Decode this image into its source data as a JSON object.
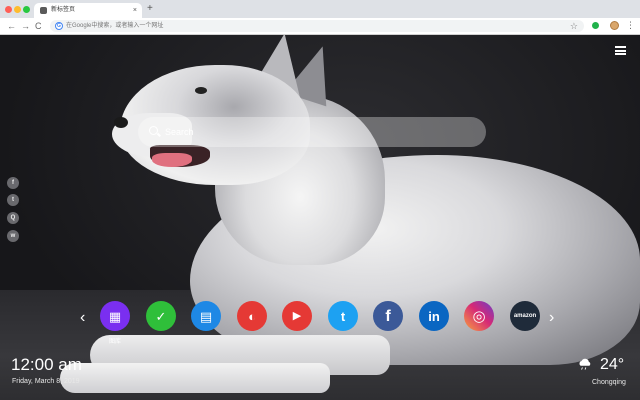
{
  "browser": {
    "tab_title": "新标签页",
    "tab_close": "×",
    "new_tab": "+",
    "back": "←",
    "forward": "→",
    "reload": "C",
    "omnibox_g": "G",
    "omnibox_placeholder": "在Google中搜索，或者输入一个网址",
    "star": "☆",
    "menu": "⋮"
  },
  "page": {
    "search": {
      "placeholder": "Search"
    },
    "social_links": [
      {
        "icon": "facebook-icon",
        "glyph": "f"
      },
      {
        "icon": "twitter-icon",
        "glyph": "t"
      },
      {
        "icon": "qq-icon",
        "glyph": "Q"
      },
      {
        "icon": "wechat-icon",
        "glyph": "w"
      }
    ],
    "dock": {
      "prev": "‹",
      "next": "›",
      "apps": [
        {
          "name": "gallery",
          "glyph": "▦",
          "label": "图库",
          "color": "#7a2ff0"
        },
        {
          "name": "checkmark",
          "glyph": "✓",
          "label": "",
          "color": "#2fbf3a"
        },
        {
          "name": "notes",
          "glyph": "▤",
          "label": "",
          "color": "#1e88e5"
        },
        {
          "name": "chrome-games",
          "glyph": "◐",
          "label": "",
          "color": "#e53935"
        },
        {
          "name": "youtube",
          "glyph": "▶",
          "label": "",
          "color": "#e53935"
        },
        {
          "name": "twitter",
          "glyph": "t",
          "label": "",
          "color": "#1da1f2"
        },
        {
          "name": "facebook",
          "glyph": "f",
          "label": "",
          "color": "#3b5998"
        },
        {
          "name": "linkedin",
          "glyph": "in",
          "label": "",
          "color": "#0a66c2"
        },
        {
          "name": "instagram",
          "glyph": "◎",
          "label": "",
          "color": "#d62976"
        },
        {
          "name": "amazon",
          "glyph": "amazon",
          "label": "",
          "color": "#1f2b3a"
        }
      ]
    },
    "clock": {
      "time": "12:00 am",
      "date": "Friday, March 8, 2019"
    },
    "weather": {
      "temp": "24°",
      "city": "Chongqing",
      "icon": "cloud-rain-icon"
    }
  }
}
